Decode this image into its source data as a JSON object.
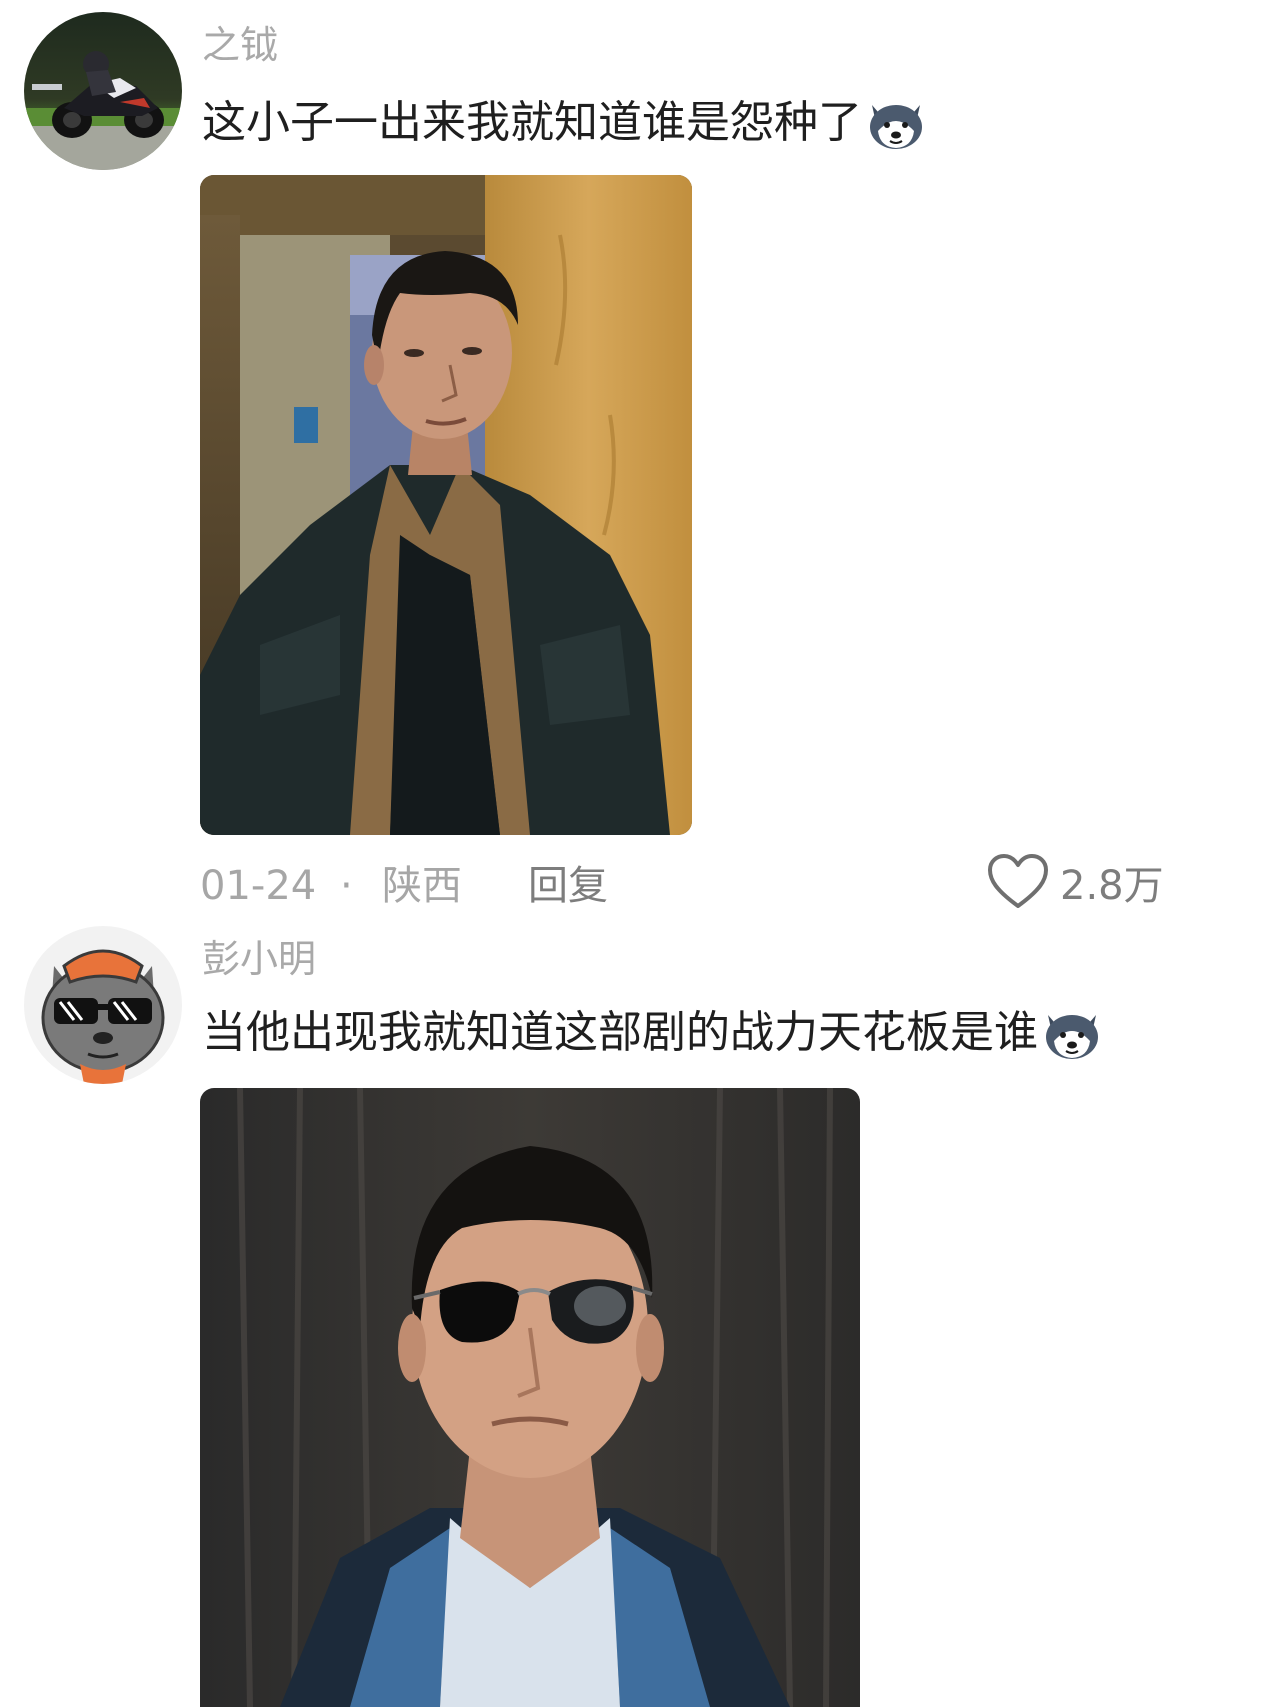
{
  "comments": [
    {
      "username": "之钺",
      "text": "这小子一出来我就知道谁是怨种了",
      "emoji": "husky-dog-emoji-icon",
      "date": "01-24",
      "separator": "·",
      "location": "陕西",
      "reply_label": "回复",
      "like_count": "2.8万",
      "avatar": "motorcycle-rider-avatar",
      "photo": "man-in-dark-jacket-photo"
    },
    {
      "username": "彭小明",
      "text": "当他出现我就知道这部剧的战力天花板是谁",
      "emoji": "husky-dog-emoji-icon",
      "avatar": "cartoon-wolf-sunglasses-avatar",
      "photo": "man-in-sunglasses-photo"
    }
  ],
  "colors": {
    "username": "#a9a9a9",
    "text": "#1f1f1f",
    "meta": "#a6a6a6",
    "action": "#7d7d7d",
    "background": "#ffffff"
  }
}
